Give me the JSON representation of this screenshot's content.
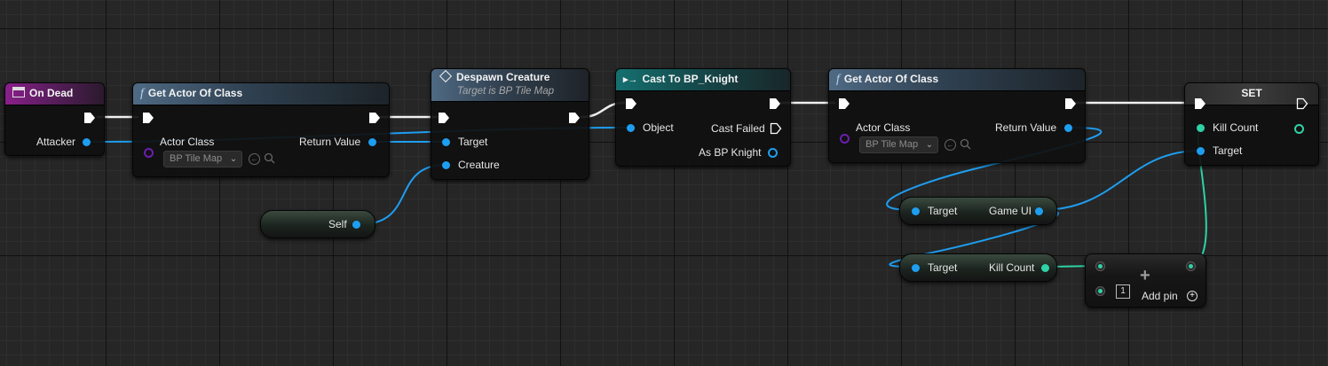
{
  "nodes": {
    "on_dead": {
      "title": "On Dead",
      "attacker": "Attacker"
    },
    "get_actor_1": {
      "title": "Get Actor Of Class",
      "actor_class": "Actor Class",
      "class_value": "BP Tile Map",
      "return_value": "Return Value"
    },
    "despawn": {
      "title": "Despawn Creature",
      "subtitle": "Target is BP Tile Map",
      "target": "Target",
      "creature": "Creature"
    },
    "cast": {
      "title": "Cast To BP_Knight",
      "object": "Object",
      "cast_failed": "Cast Failed",
      "as_knight": "As BP Knight"
    },
    "get_actor_2": {
      "title": "Get Actor Of Class",
      "actor_class": "Actor Class",
      "class_value": "BP Tile Map",
      "return_value": "Return Value"
    },
    "set": {
      "title": "SET",
      "kill_count": "Kill Count",
      "target": "Target"
    },
    "self": {
      "label": "Self"
    },
    "game_ui": {
      "target": "Target",
      "output": "Game UI"
    },
    "kill_count_get": {
      "target": "Target",
      "output": "Kill Count"
    },
    "add": {
      "index": "1",
      "add_pin": "Add pin"
    }
  },
  "colors": {
    "exec": "#ffffff",
    "object_pin": "#1e9ef0",
    "int_pin": "#2fd2a5",
    "class_pin": "#6b1fb0"
  }
}
